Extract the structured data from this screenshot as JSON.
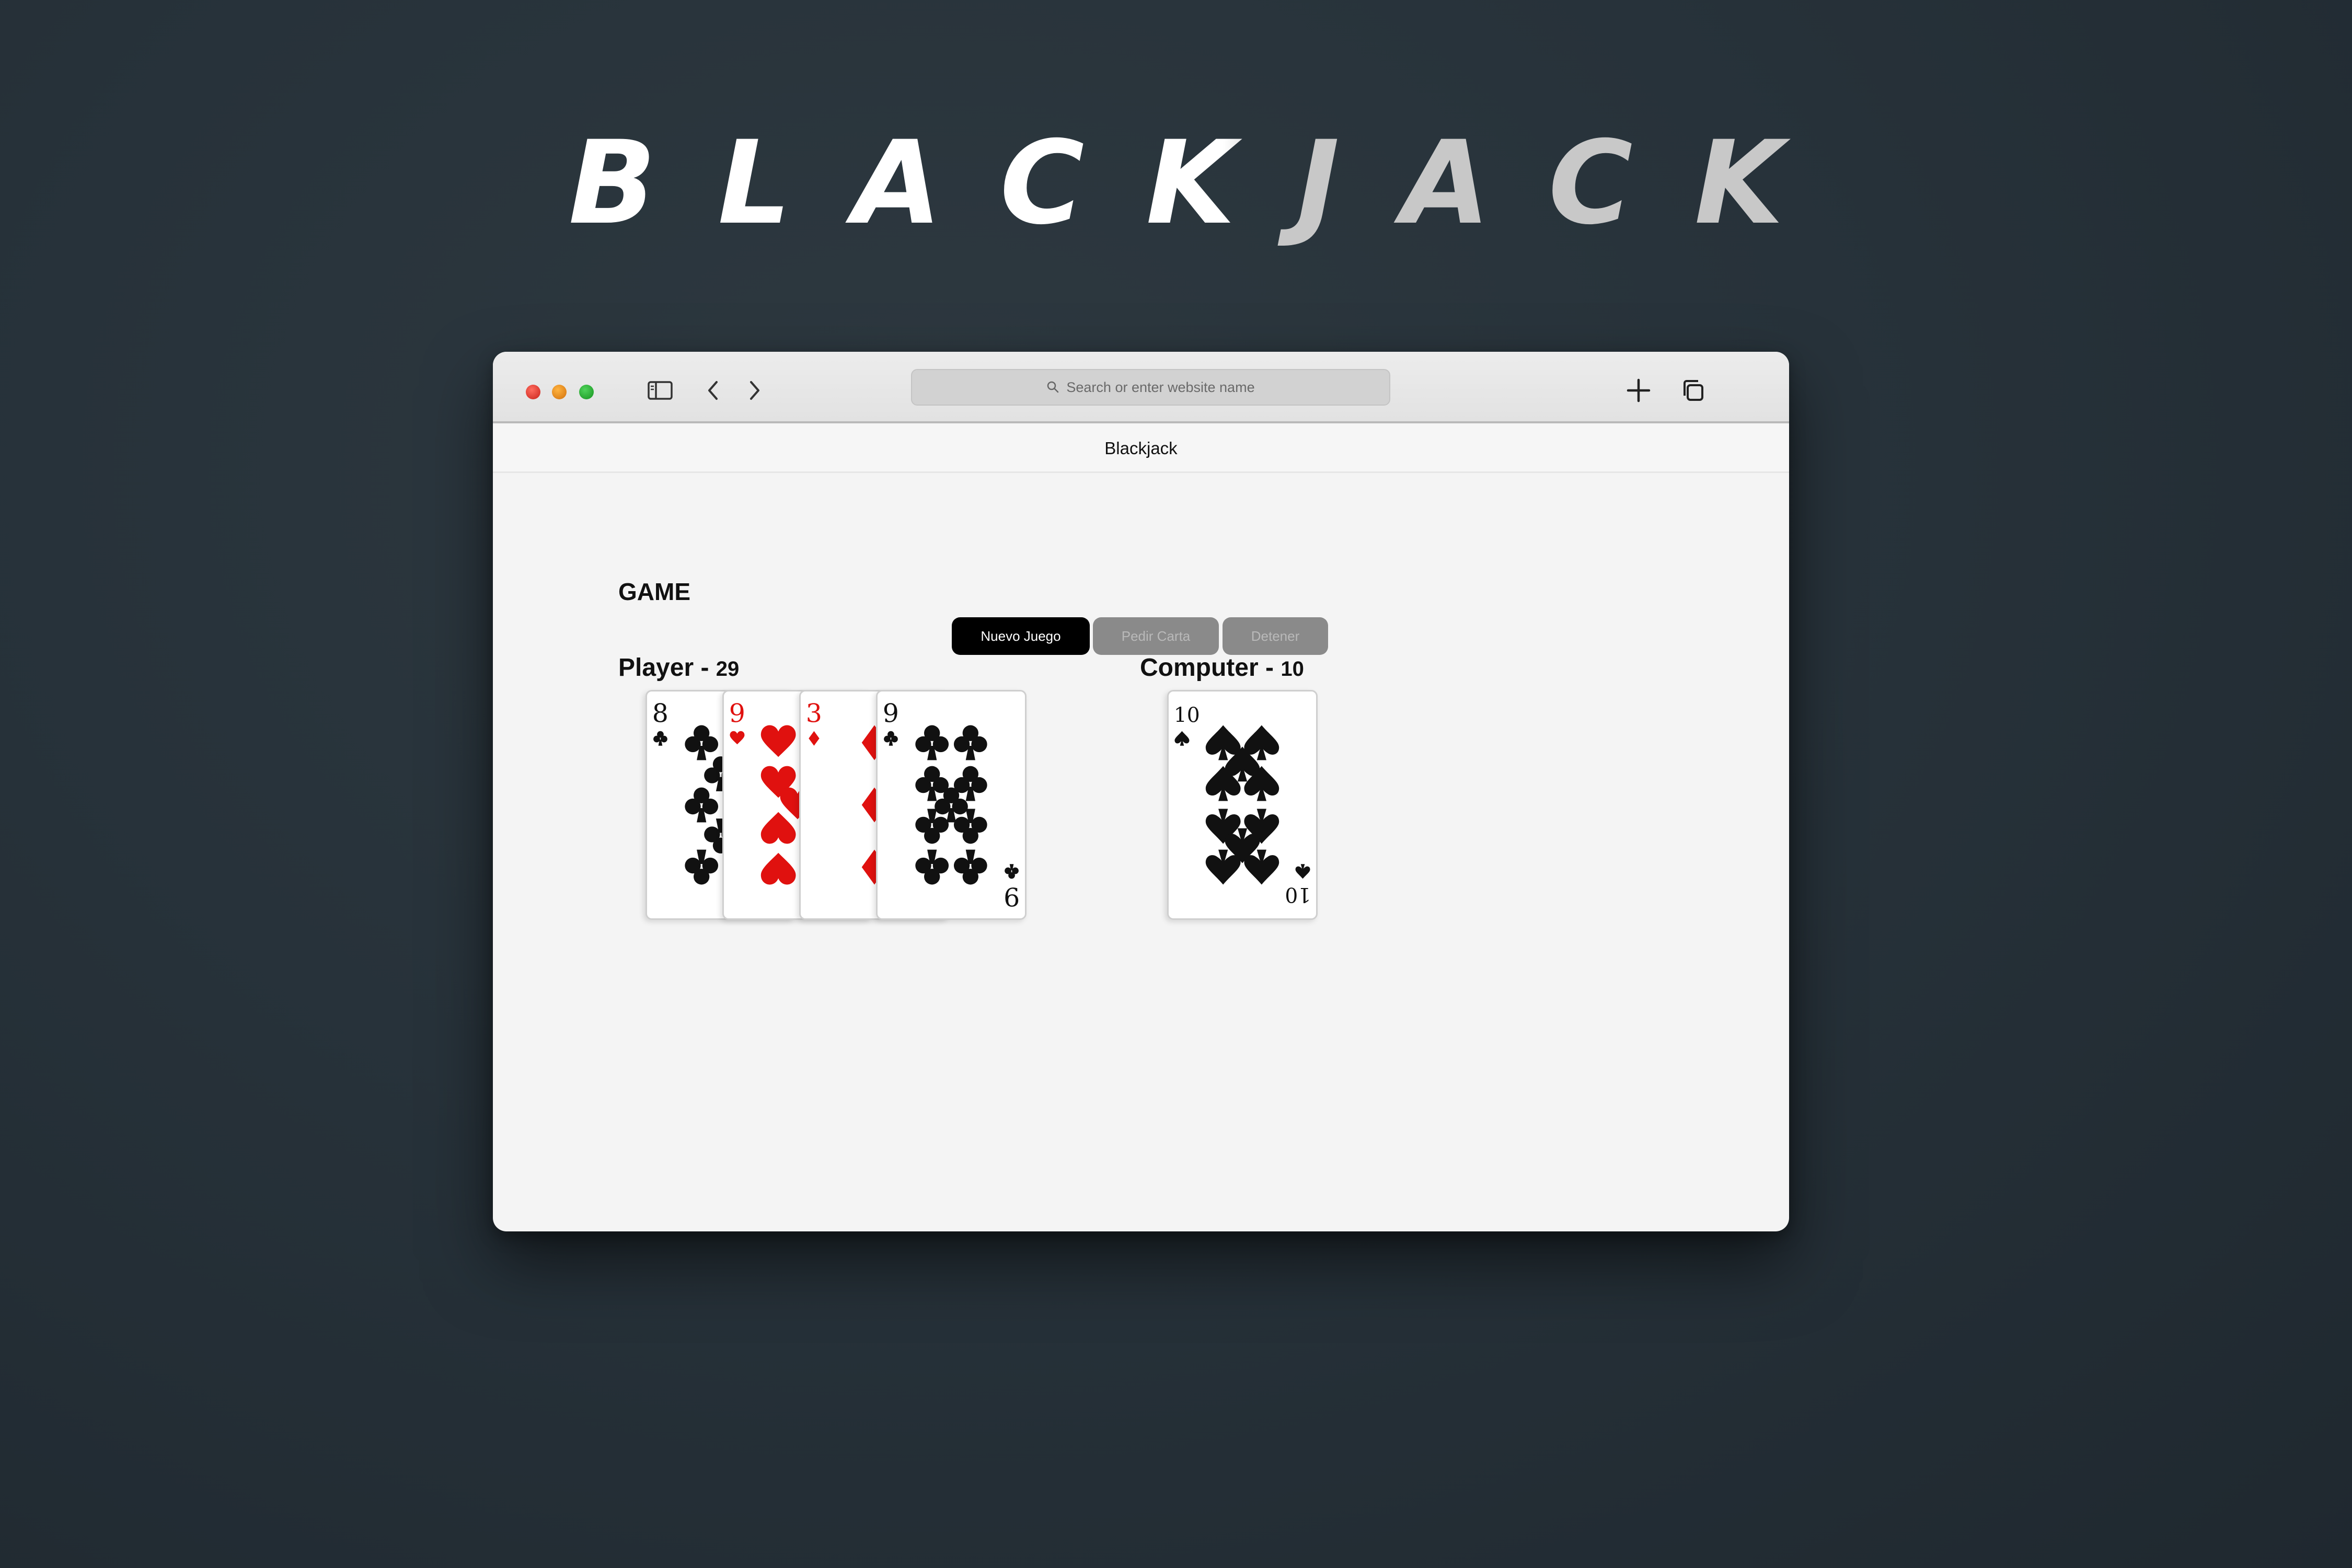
{
  "hero": {
    "title": "BLACKJACK"
  },
  "browser": {
    "address_placeholder": "Search or enter website name",
    "tab_title": "Blackjack",
    "icons": [
      "sidebar-icon",
      "back-icon",
      "forward-icon",
      "new-tab-icon",
      "tab-overview-icon"
    ]
  },
  "game": {
    "heading": "GAME",
    "buttons": {
      "new_game": "Nuevo Juego",
      "draw_card": "Pedir Carta",
      "stop": "Detener"
    },
    "player": {
      "label": "Player -",
      "points": "29"
    },
    "computer": {
      "label": "Computer -",
      "points": "10"
    },
    "player_cards": [
      {
        "rank": "8",
        "suit": "clubs",
        "color": "#111111"
      },
      {
        "rank": "9",
        "suit": "hearts",
        "color": "#e0110f"
      },
      {
        "rank": "3",
        "suit": "diamonds",
        "color": "#e0110f"
      },
      {
        "rank": "9",
        "suit": "clubs",
        "color": "#111111"
      }
    ],
    "computer_cards": [
      {
        "rank": "10",
        "suit": "spades",
        "color": "#111111"
      }
    ]
  },
  "colors": {
    "background": "#27323a",
    "primary_button": "#000000",
    "disabled_button": "#8a8a8a",
    "red_suit": "#e0110f"
  }
}
